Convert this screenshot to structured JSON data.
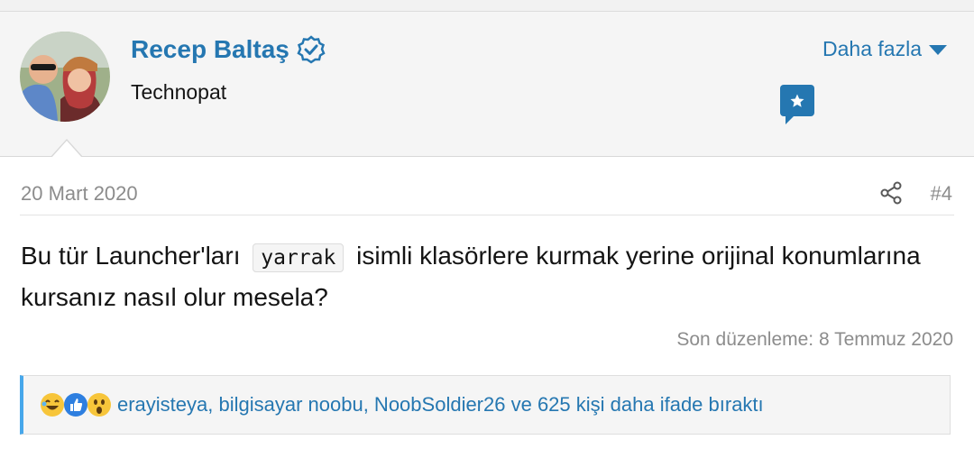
{
  "user": {
    "name": "Recep Baltaş",
    "title": "Technopat",
    "more_label": "Daha fazla"
  },
  "post": {
    "date": "20 Mart 2020",
    "number": "#4",
    "text_before": "Bu tür Launcher'ları",
    "code": "yarrak",
    "text_after": "isimli klasörlere kurmak yerine orijinal konumlarına kursanız nasıl olur mesela?",
    "last_edit": "Son düzenleme: 8 Temmuz 2020"
  },
  "reactions": {
    "icons": [
      "laugh-icon",
      "like-icon",
      "wow-icon"
    ],
    "text": "erayisteya, bilgisayar noobu, NoobSoldier26 ve 625 kişi daha ifade bıraktı"
  },
  "colors": {
    "accent": "#2577b1",
    "reaction_border": "#47a7eb",
    "muted": "#8c8c8c"
  }
}
